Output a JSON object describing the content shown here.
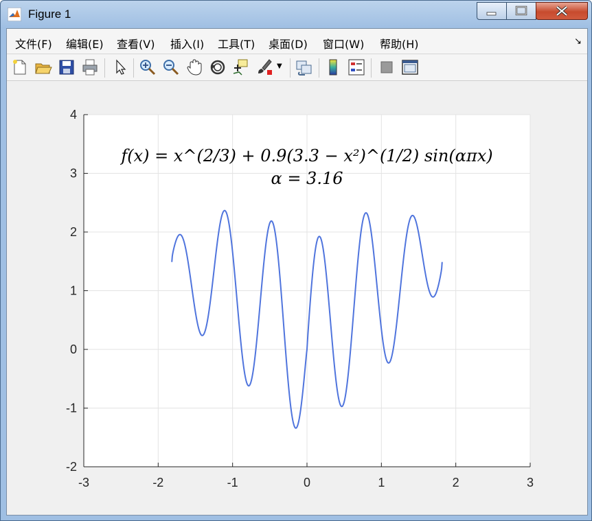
{
  "window": {
    "title": "Figure 1"
  },
  "menu": {
    "items": [
      "文件(F)",
      "编辑(E)",
      "查看(V)",
      "插入(I)",
      "工具(T)",
      "桌面(D)",
      "窗口(W)",
      "帮助(H)"
    ]
  },
  "toolbar": {
    "icons": [
      "new-figure-icon",
      "open-file-icon",
      "save-icon",
      "print-icon",
      "pointer-icon",
      "zoom-in-icon",
      "zoom-out-icon",
      "pan-hand-icon",
      "rotate-3d-icon",
      "data-cursor-icon",
      "brush-icon",
      "link-plot-icon",
      "colorbar-icon",
      "legend-icon",
      "hide-plot-tools-icon",
      "show-plot-tools-icon"
    ]
  },
  "chart_data": {
    "type": "line",
    "title": "",
    "annotation_lines": [
      "f(x) = x^(2/3) + 0.9(3.3 − x²)^(1/2) sin(απx)",
      "α = 3.16"
    ],
    "xlim": [
      -3,
      3
    ],
    "ylim": [
      -2,
      4
    ],
    "x_ticks": [
      "-3",
      "-2",
      "-1",
      "0",
      "1",
      "2",
      "3"
    ],
    "y_ticks": [
      "-2",
      "-1",
      "0",
      "1",
      "2",
      "3",
      "4"
    ],
    "grid": true,
    "series": [
      {
        "color": "#4f74dd",
        "x_range": [
          -1.8166,
          1.8166
        ],
        "alpha": 3.16,
        "samples": 600,
        "formula": "abs(x)^(2/3) + 0.9*sqrt(3.3 - x^2)*sin(alpha*pi*x)"
      }
    ]
  }
}
